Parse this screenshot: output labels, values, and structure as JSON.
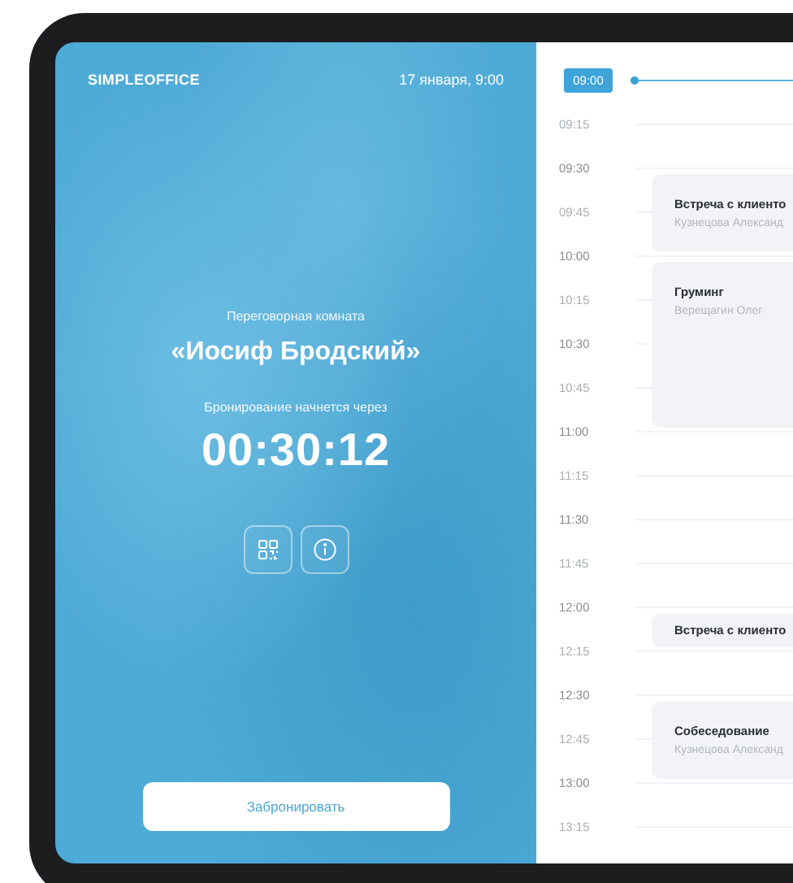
{
  "brand": "SIMPLEOFFICE",
  "datetime": "17 января, 9:00",
  "room": {
    "caption": "Переговорная комната",
    "name": "«Иосиф Бродский»"
  },
  "countdown": {
    "caption": "Бронирование начнется через",
    "time": "00:30:12"
  },
  "icon_buttons": [
    {
      "kind": "qr"
    },
    {
      "kind": "info"
    }
  ],
  "book_button": "Забронировать",
  "timeline": [
    {
      "time": "09:00",
      "kind": "major",
      "selected": true
    },
    {
      "time": "09:15",
      "kind": "minor",
      "selected": false
    },
    {
      "time": "09:30",
      "kind": "major",
      "selected": false,
      "event": {
        "title": "Встреча с клиенто",
        "person": "Кузнецова Александ",
        "kind": "half-hour"
      }
    },
    {
      "time": "09:45",
      "kind": "minor",
      "selected": false
    },
    {
      "time": "10:00",
      "kind": "major",
      "selected": false,
      "event": {
        "title": "Груминг",
        "person": "Верещагин Олег",
        "kind": "hour"
      }
    },
    {
      "time": "10:15",
      "kind": "minor",
      "selected": false
    },
    {
      "time": "10:30",
      "kind": "major",
      "selected": false
    },
    {
      "time": "10:45",
      "kind": "minor",
      "selected": false
    },
    {
      "time": "11:00",
      "kind": "major",
      "selected": false
    },
    {
      "time": "11:15",
      "kind": "minor",
      "selected": false
    },
    {
      "time": "11:30",
      "kind": "major",
      "selected": false
    },
    {
      "time": "11:45",
      "kind": "minor",
      "selected": false
    },
    {
      "time": "12:00",
      "kind": "major",
      "selected": false,
      "event": {
        "title": "Встреча с клиенто",
        "kind": "quarter"
      }
    },
    {
      "time": "12:15",
      "kind": "minor",
      "selected": false
    },
    {
      "time": "12:30",
      "kind": "major",
      "selected": false,
      "event": {
        "title": "Собеседование",
        "person": "Кузнецова Александ",
        "kind": "half-hour"
      }
    },
    {
      "time": "12:45",
      "kind": "minor",
      "selected": false
    },
    {
      "time": "13:00",
      "kind": "major",
      "selected": false
    },
    {
      "time": "13:15",
      "kind": "minor",
      "selected": false
    }
  ]
}
